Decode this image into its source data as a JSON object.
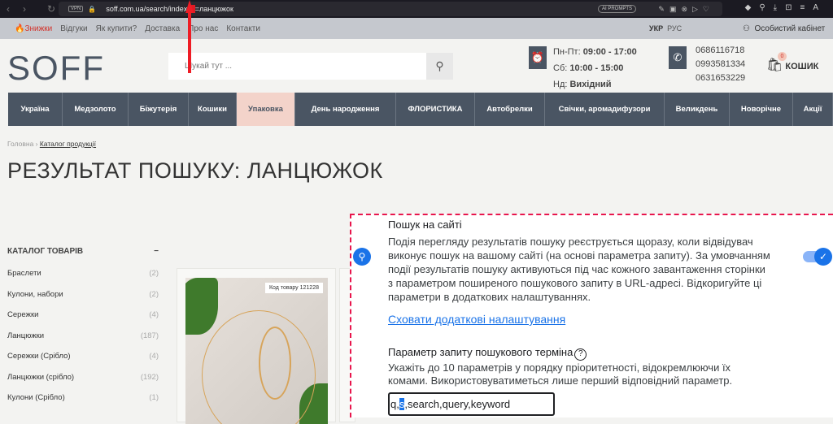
{
  "browser": {
    "url_prefix": "soff.com.ua/search/index?",
    "url_highlight": "s",
    "url_suffix": "=ланцюжок",
    "vpn": "VPN",
    "ai_prompts": "AI PROMPTS"
  },
  "topnav": {
    "items": [
      "Знижки",
      "Відгуки",
      "Як купити?",
      "Доставка",
      "Про нас",
      "Контакти"
    ],
    "lang_active": "УКР",
    "lang_other": "РУС",
    "cabinet": "Особистий кабінет"
  },
  "header": {
    "logo": "SOFF",
    "search_placeholder": "Шукай тут ...",
    "hours": [
      {
        "label": "Пн-Пт: ",
        "value": "09:00 - 17:00"
      },
      {
        "label": "Сб: ",
        "value": "10:00 - 15:00"
      },
      {
        "label": "Нд: ",
        "value": "Вихідний"
      }
    ],
    "phones": [
      "0686116718",
      "0993581334",
      "0631653229"
    ],
    "cart_label": "КОШИК",
    "cart_count": "0"
  },
  "categories": [
    "Україна",
    "Медзолото",
    "Біжутерія",
    "Кошики",
    "Упаковка",
    "День народження",
    "ФЛОРИСТИКА",
    "Автобрелки",
    "Свічки, аромадифузори",
    "Великдень",
    "Новорічне",
    "Акції"
  ],
  "breadcrumb": {
    "home": "Головна",
    "current": "Каталог продукції"
  },
  "page_title": "РЕЗУЛЬТАТ ПОШУКУ: ЛАНЦЮЖОК",
  "sidebar": {
    "heading": "КАТАЛОГ ТОВАРІВ",
    "items": [
      {
        "label": "Браслети",
        "count": "(2)"
      },
      {
        "label": "Кулони, набори",
        "count": "(2)"
      },
      {
        "label": "Сережки",
        "count": "(4)"
      },
      {
        "label": "Ланцюжки",
        "count": "(187)"
      },
      {
        "label": "Сережки (Срібло)",
        "count": "(4)"
      },
      {
        "label": "Ланцюжки (срібло)",
        "count": "(192)"
      },
      {
        "label": "Кулони (Срібло)",
        "count": "(1)"
      }
    ]
  },
  "product": {
    "code": "Код товару 121228"
  },
  "panel": {
    "title": "Пошук на сайті",
    "description": "Подія перегляду результатів пошуку реєструється щоразу, коли відвідувач виконує пошук на вашому сайті (на основі параметра запиту). За умовчанням події результатів пошуку активуються під час кожного завантаження сторінки з параметром поширеного пошукового запиту в URL-адресі. Відкоригуйте ці параметри в додаткових налаштуваннях.",
    "toggle_on": true,
    "link": "Сховати додаткові налаштування",
    "param_title": "Параметр запиту пошукового терміна",
    "param_desc": "Укажіть до 10 параметрів у порядку пріоритетності, відокремлюючи їх комами. Використовуватиметься лише перший відповідний параметр.",
    "input_before": "q,",
    "input_selected": "s",
    "input_after": ",search,query,keyword"
  },
  "colors": {
    "accent": "#e8164d",
    "nav": "#4a5563",
    "active_nav": "#f3d3ca",
    "google_blue": "#1a73e8"
  }
}
